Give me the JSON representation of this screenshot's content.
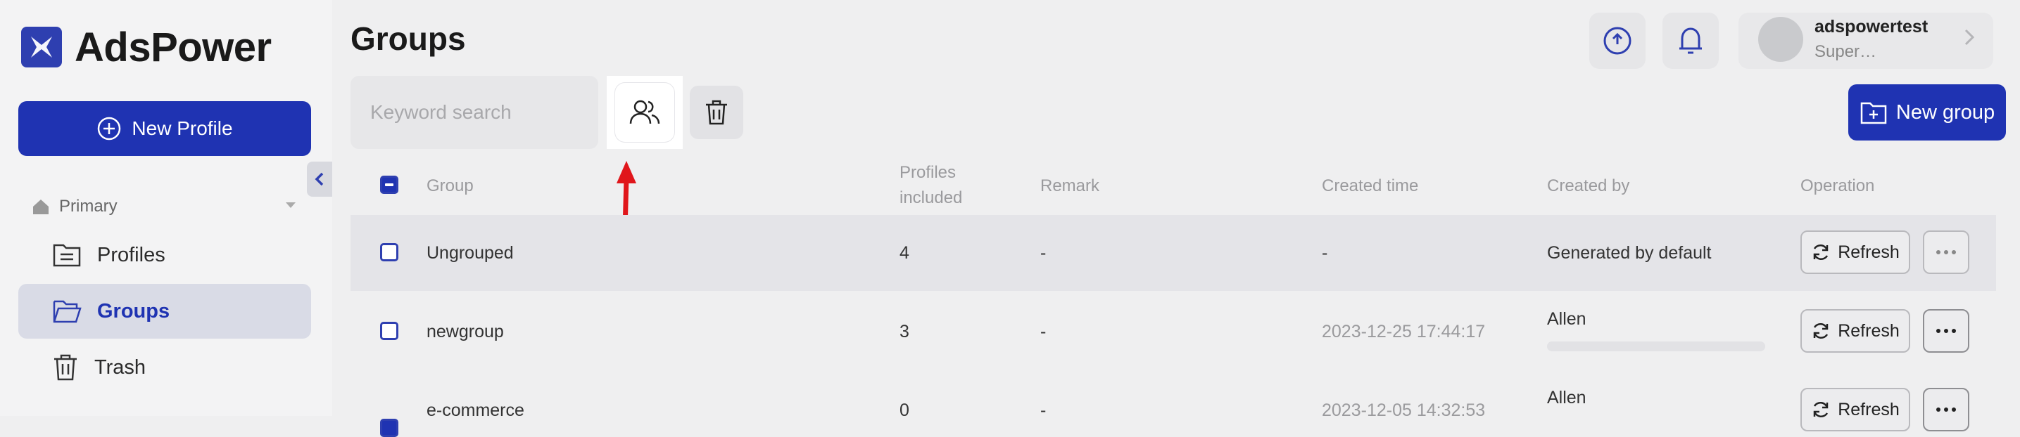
{
  "app": {
    "name": "AdsPower"
  },
  "sidebar": {
    "new_profile_label": "New Profile",
    "section_label": "Primary",
    "items": [
      {
        "label": "Profiles",
        "icon": "folder-list-icon"
      },
      {
        "label": "Groups",
        "icon": "folder-open-icon",
        "active": true
      },
      {
        "label": "Trash",
        "icon": "trash-icon"
      }
    ]
  },
  "header": {
    "title": "Groups",
    "user": {
      "name": "adspowertest",
      "role": "Super…"
    }
  },
  "toolbar": {
    "search_placeholder": "Keyword search",
    "new_group_label": "New group"
  },
  "table": {
    "headers": {
      "group": "Group",
      "profiles_line1": "Profiles",
      "profiles_line2": "included",
      "remark": "Remark",
      "created_time": "Created time",
      "created_by": "Created by",
      "operation": "Operation"
    },
    "rows": [
      {
        "group": "Ungrouped",
        "profiles": "4",
        "remark": "-",
        "created_time": "-",
        "created_by": "Generated by default",
        "checked": false
      },
      {
        "group": "newgroup",
        "profiles": "3",
        "remark": "-",
        "created_time": "2023-12-25 17:44:17",
        "created_by": "Allen",
        "checked": false
      },
      {
        "group": "e-commerce",
        "profiles": "0",
        "remark": "-",
        "created_time": "2023-12-05 14:32:53",
        "created_by": "Allen",
        "checked": true
      }
    ],
    "refresh_label": "Refresh"
  },
  "colors": {
    "brand": "#1f33b2",
    "annotation_arrow": "#e0161b"
  }
}
